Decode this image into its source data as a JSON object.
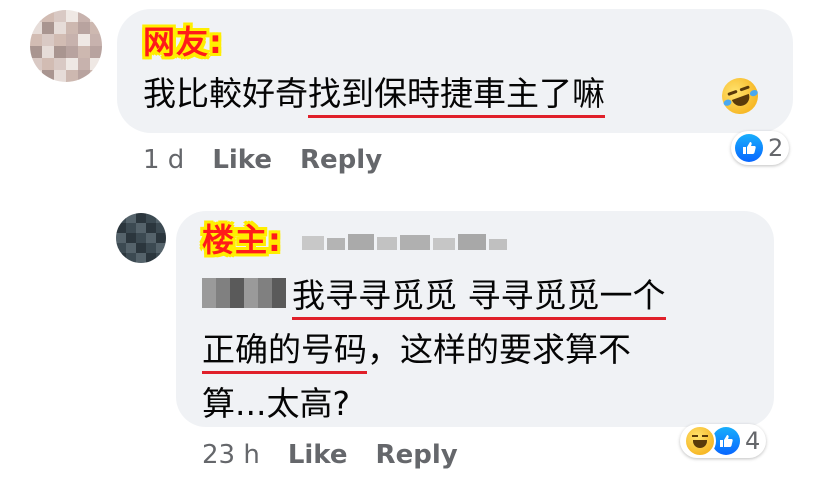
{
  "comment1": {
    "tag": "网友:",
    "text_plain": "我比較好奇",
    "text_underlined": "找到保時捷車主了嘛",
    "emoji": "rofl-emoji",
    "time": "1 d",
    "like_label": "Like",
    "reply_label": "Reply",
    "reaction_count": "2"
  },
  "comment2": {
    "tag": "楼主:",
    "line1_underlined": "我寻寻觅觅 寻寻觅觅一个",
    "line2_underlined": "正确的号码",
    "line2_plain": "，这样的要求算不",
    "line3": "算...太高?",
    "time": "23 h",
    "like_label": "Like",
    "reply_label": "Reply",
    "reaction_count": "4"
  },
  "colors": {
    "bubble": "#f0f2f5",
    "underline": "#e0202a",
    "tag_text": "#ff1a1a",
    "tag_outline": "#ffee00",
    "meta": "#65676b",
    "like_blue": "#0866ff"
  }
}
